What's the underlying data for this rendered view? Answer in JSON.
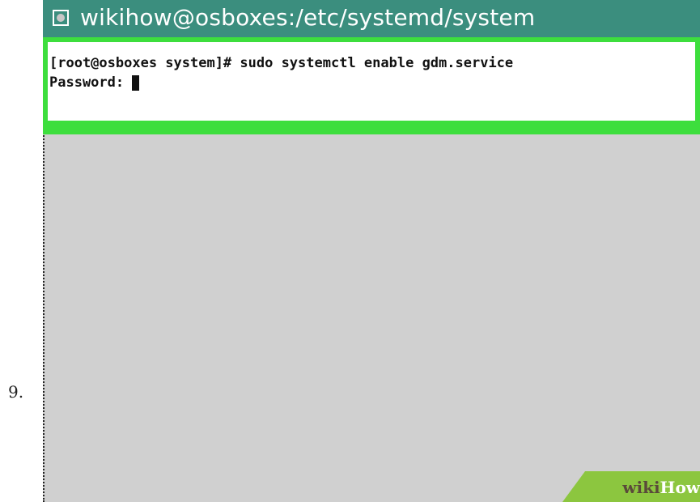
{
  "step": {
    "number": "9."
  },
  "window": {
    "title": "wikihow@osboxes:/etc/systemd/system",
    "icon": "window-menu-icon"
  },
  "terminal": {
    "command_line": "[root@osboxes system]# sudo systemctl enable gdm.service",
    "password_prompt": "Password:",
    "cursor": "block-cursor-icon"
  },
  "watermark": {
    "wiki": "wiki",
    "how": "How"
  },
  "colors": {
    "titlebar": "#3b8e7e",
    "highlight": "#3dde3d",
    "terminal_bg": "#ffffff",
    "desktop_bg": "#d0d0d0",
    "watermark_green": "#8cc63f"
  }
}
